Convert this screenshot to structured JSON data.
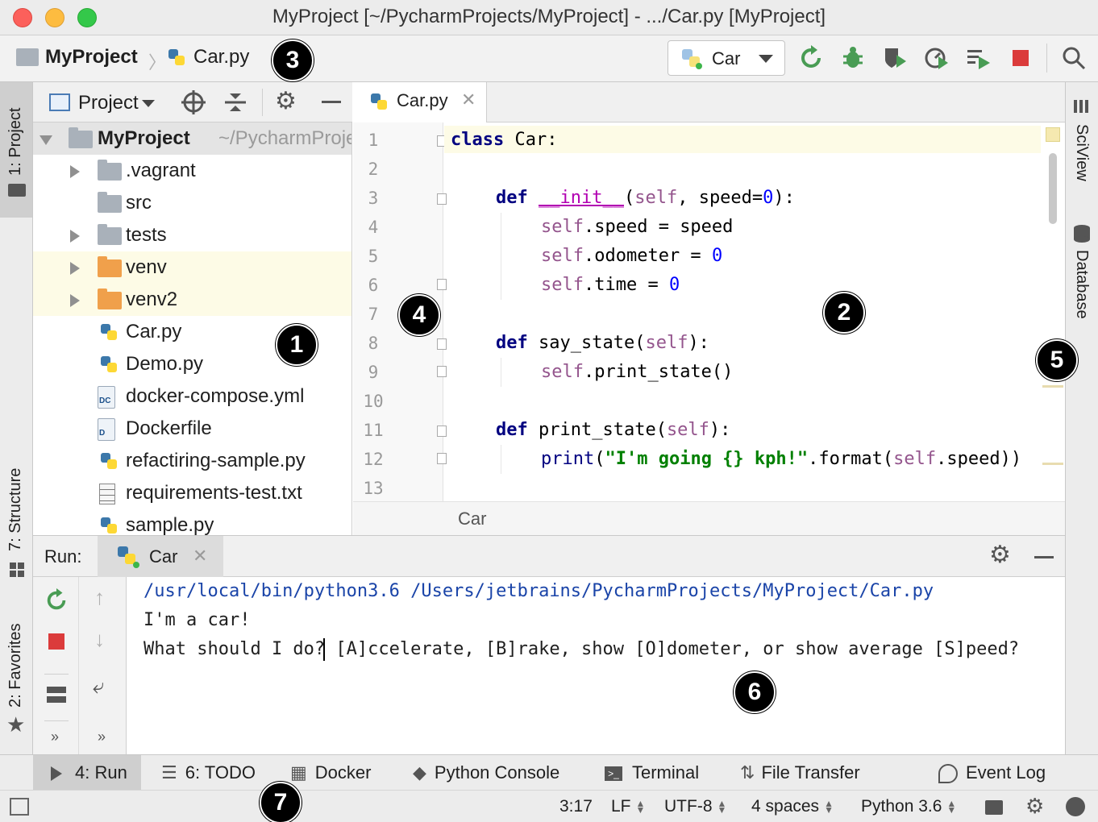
{
  "window": {
    "title": "MyProject [~/PycharmProjects/MyProject] - .../Car.py [MyProject]"
  },
  "navbar": {
    "crumbs": [
      "MyProject",
      "Car.py"
    ],
    "run_config": "Car"
  },
  "left_stripe": {
    "project": "1: Project",
    "structure": "7: Structure",
    "favorites": "2: Favorites"
  },
  "right_stripe": {
    "sciview": "SciView",
    "database": "Database"
  },
  "project_panel": {
    "view_label": "Project",
    "root": {
      "name": "MyProject",
      "path": "~/PycharmProjects/MyProject"
    },
    "items": [
      {
        "name": ".vagrant",
        "kind": "folder",
        "expandable": true
      },
      {
        "name": "src",
        "kind": "folder",
        "expandable": false
      },
      {
        "name": "tests",
        "kind": "folder",
        "expandable": true
      },
      {
        "name": "venv",
        "kind": "folder-excluded",
        "expandable": true
      },
      {
        "name": "venv2",
        "kind": "folder-excluded",
        "expandable": true
      },
      {
        "name": "Car.py",
        "kind": "python"
      },
      {
        "name": "Demo.py",
        "kind": "python"
      },
      {
        "name": "docker-compose.yml",
        "kind": "docker-compose",
        "badge": "DC"
      },
      {
        "name": "Dockerfile",
        "kind": "dockerfile",
        "badge": "D"
      },
      {
        "name": "refactiring-sample.py",
        "kind": "python"
      },
      {
        "name": "requirements-test.txt",
        "kind": "text"
      },
      {
        "name": "sample.py",
        "kind": "python"
      }
    ]
  },
  "editor": {
    "tab": "Car.py",
    "line_numbers": [
      "1",
      "2",
      "3",
      "4",
      "5",
      "6",
      "7",
      "8",
      "9",
      "10",
      "11",
      "12",
      "13"
    ],
    "breadcrumb": "Car",
    "code": {
      "l1_kw": "class",
      "l1_rest": " Car:",
      "l3_kw": "def",
      "l3_name": "__init__",
      "l3_a": "(",
      "l3_self": "self",
      "l3_b": ", speed=",
      "l3_num": "0",
      "l3_c": "):",
      "l4_self": "self",
      "l4_rest": ".speed = speed",
      "l5_self": "self",
      "l5_rest": ".odometer = ",
      "l5_num": "0",
      "l6_self": "self",
      "l6_rest": ".time = ",
      "l6_num": "0",
      "l8_kw": "def",
      "l8_a": " say_state(",
      "l8_self": "self",
      "l8_b": "):",
      "l9_self": "self",
      "l9_rest": ".print_state()",
      "l11_kw": "def",
      "l11_a": " print_state(",
      "l11_self": "self",
      "l11_b": "):",
      "l12_kw": "print",
      "l12_a": "(",
      "l12_str": "\"I'm going {} kph!\"",
      "l12_b": ".format(",
      "l12_self": "self",
      "l12_c": ".speed))"
    }
  },
  "run_panel": {
    "label": "Run:",
    "tab": "Car",
    "console": [
      "/usr/local/bin/python3.6 /Users/jetbrains/PycharmProjects/MyProject/Car.py",
      "I'm a car!",
      "What should I do? [A]ccelerate, [B]rake, show [O]dometer, or show average [S]peed?"
    ]
  },
  "tool_windows": {
    "run": "4: Run",
    "todo": "6: TODO",
    "docker": "Docker",
    "python_console": "Python Console",
    "terminal": "Terminal",
    "file_transfer": "File Transfer",
    "event_log": "Event Log"
  },
  "status_bar": {
    "position": "3:17",
    "line_sep": "LF",
    "encoding": "UTF-8",
    "indent": "4 spaces",
    "interpreter": "Python 3.6"
  },
  "callouts": [
    "1",
    "2",
    "3",
    "4",
    "5",
    "6",
    "7"
  ],
  "colors": {
    "keyword": "#000080",
    "self": "#94558d",
    "number": "#0000ff",
    "string": "#008000",
    "console_path": "#1a44a8",
    "run_green": "#499c54",
    "stop_red": "#db3b3b"
  }
}
